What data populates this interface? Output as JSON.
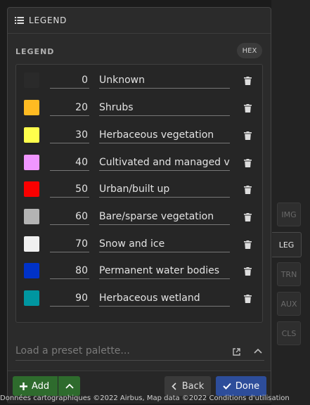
{
  "side_tabs": [
    {
      "label": "IMG"
    },
    {
      "label": "LEG"
    },
    {
      "label": "TRN"
    },
    {
      "label": "AUX"
    },
    {
      "label": "CLS"
    }
  ],
  "panel": {
    "title": "LEGEND"
  },
  "section": {
    "title": "LEGEND",
    "hex_label": "HEX"
  },
  "legend": [
    {
      "color": "#2a2a2a",
      "value": "0",
      "label": "Unknown"
    },
    {
      "color": "#ffbb22",
      "value": "20",
      "label": "Shrubs"
    },
    {
      "color": "#ffff4c",
      "value": "30",
      "label": "Herbaceous vegetation"
    },
    {
      "color": "#f096ff",
      "value": "40",
      "label": "Cultivated and managed vegetation"
    },
    {
      "color": "#fa0000",
      "value": "50",
      "label": "Urban/built up"
    },
    {
      "color": "#b4b4b4",
      "value": "60",
      "label": "Bare/sparse vegetation"
    },
    {
      "color": "#f0f0f0",
      "value": "70",
      "label": "Snow and ice"
    },
    {
      "color": "#0032c8",
      "value": "80",
      "label": "Permanent water bodies"
    },
    {
      "color": "#0096a0",
      "value": "90",
      "label": "Herbaceous wetland"
    }
  ],
  "preset": {
    "placeholder": "Load a preset palette..."
  },
  "footer": {
    "add_label": "Add",
    "back_label": "Back",
    "done_label": "Done"
  },
  "attribution": "Données cartographiques ©2022 Airbus, Map data ©2022 Conditions d'utilisation"
}
